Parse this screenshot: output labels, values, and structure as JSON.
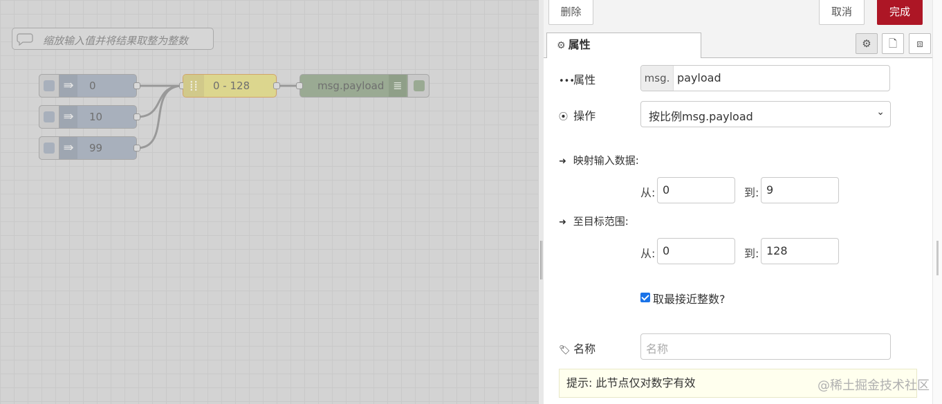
{
  "canvas": {
    "comment": "缩放输入值并将结果取整为整数",
    "inject_nodes": [
      "0",
      "10",
      "99"
    ],
    "range_node": "0 - 128",
    "debug_node": "msg.payload"
  },
  "tray": {
    "delete_label": "删除",
    "cancel_label": "取消",
    "done_label": "完成",
    "tab_label": "属性"
  },
  "form": {
    "property_label": "属性",
    "property_prefix": "msg.",
    "property_value": "payload",
    "action_label": "操作",
    "action_value": "按比例msg.payload",
    "input_range_label": "映射输入数据:",
    "from_label": "从:",
    "to_label": "到:",
    "input_from": "0",
    "input_to": "9",
    "target_range_label": "至目标范围:",
    "target_from": "0",
    "target_to": "128",
    "round_label": "取最接近整数?",
    "round_checked": true,
    "name_label": "名称",
    "name_placeholder": "名称",
    "tip": "提示: 此节点仅对数字有效"
  },
  "watermark": "@稀土掘金技术社区",
  "colors": {
    "done_button": "#ad1625",
    "inject_node": "#a8b0bc",
    "range_node": "#dcd68e",
    "debug_node": "#9aaa93",
    "tip_background": "#ffffee"
  }
}
